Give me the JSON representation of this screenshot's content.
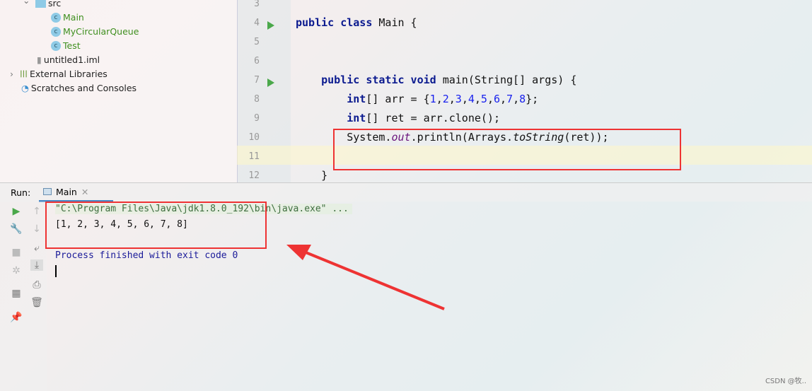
{
  "project_tree": [
    {
      "label": "src",
      "type": "folder"
    },
    {
      "label": "Main",
      "type": "class-runnable"
    },
    {
      "label": "MyCircularQueue",
      "type": "class"
    },
    {
      "label": "Test",
      "type": "class-runnable"
    },
    {
      "label": "untitled1.iml",
      "type": "file"
    },
    {
      "label": "External Libraries",
      "type": "libraries"
    },
    {
      "label": "Scratches and Consoles",
      "type": "scratches"
    }
  ],
  "editor": {
    "line_numbers": [
      "3",
      "4",
      "5",
      "6",
      "7",
      "8",
      "9",
      "10",
      "11",
      "12"
    ],
    "lines": [
      [],
      [
        {
          "t": "public class ",
          "c": "kw"
        },
        {
          "t": "Main {",
          "c": ""
        }
      ],
      [],
      [],
      [
        {
          "t": "    public static void ",
          "c": "kw"
        },
        {
          "t": "main(String[] args) {",
          "c": ""
        }
      ],
      [
        {
          "t": "        int",
          "c": "kw"
        },
        {
          "t": "[] arr = {",
          "c": ""
        },
        {
          "t": "1",
          "c": "num"
        },
        {
          "t": ",",
          "c": ""
        },
        {
          "t": "2",
          "c": "num"
        },
        {
          "t": ",",
          "c": ""
        },
        {
          "t": "3",
          "c": "num"
        },
        {
          "t": ",",
          "c": ""
        },
        {
          "t": "4",
          "c": "num"
        },
        {
          "t": ",",
          "c": ""
        },
        {
          "t": "5",
          "c": "num"
        },
        {
          "t": ",",
          "c": ""
        },
        {
          "t": "6",
          "c": "num"
        },
        {
          "t": ",",
          "c": ""
        },
        {
          "t": "7",
          "c": "num"
        },
        {
          "t": ",",
          "c": ""
        },
        {
          "t": "8",
          "c": "num"
        },
        {
          "t": "};",
          "c": ""
        }
      ],
      [
        {
          "t": "        int",
          "c": "kw"
        },
        {
          "t": "[] ret = arr.clone();",
          "c": ""
        }
      ],
      [
        {
          "t": "        System.",
          "c": ""
        },
        {
          "t": "out",
          "c": "fld"
        },
        {
          "t": ".println(Arrays.",
          "c": ""
        },
        {
          "t": "toString",
          "c": "it"
        },
        {
          "t": "(ret));",
          "c": ""
        }
      ],
      [],
      [
        {
          "t": "    }",
          "c": ""
        }
      ]
    ]
  },
  "run": {
    "label": "Run:",
    "tab": "Main"
  },
  "console": {
    "command": "\"C:\\Program Files\\Java\\jdk1.8.0_192\\bin\\java.exe\" ...",
    "output": "[1, 2, 3, 4, 5, 6, 7, 8]",
    "exit": "Process finished with exit code 0"
  },
  "watermark": "CSDN @牧.."
}
